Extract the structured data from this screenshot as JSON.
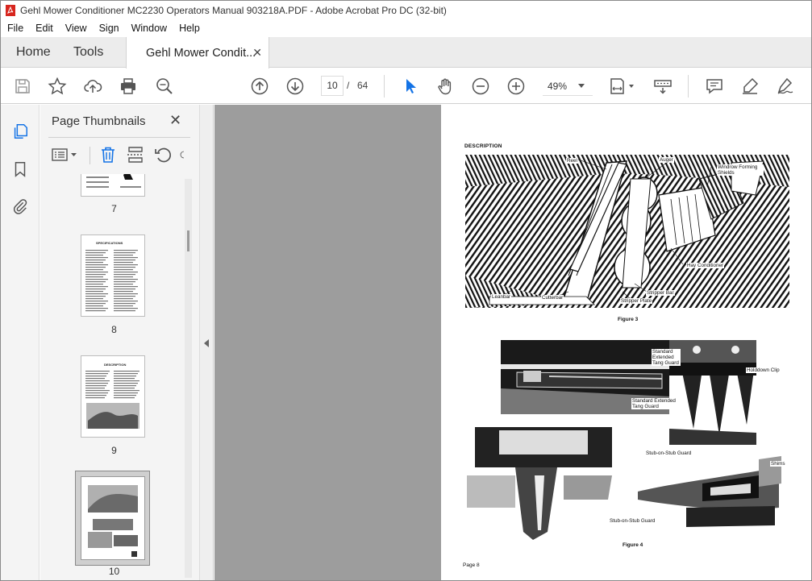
{
  "window": {
    "title": "Gehl Mower Conditioner MC2230 Operators Manual 903218A.PDF - Adobe Acrobat Pro DC (32-bit)"
  },
  "menu": [
    "File",
    "Edit",
    "View",
    "Sign",
    "Window",
    "Help"
  ],
  "tabs": {
    "home": "Home",
    "tools": "Tools",
    "document": "Gehl Mower Condit..."
  },
  "toolbar": {
    "current_page": "10",
    "page_separator": "/",
    "total_pages": "64",
    "zoom": "49%"
  },
  "thumbnails_panel": {
    "title": "Page Thumbnails",
    "pages": [
      {
        "label": "7"
      },
      {
        "label": "8",
        "heading": "SPECIFICATIONS"
      },
      {
        "label": "9",
        "heading": "DESCRIPTION"
      },
      {
        "label": "10",
        "selected": true
      }
    ]
  },
  "page": {
    "heading": "DESCRIPTION",
    "figure3": {
      "caption": "Figure 3",
      "labels": [
        "Reel",
        "Auger",
        "Windrow Forming Shields",
        "Hay Conditioner",
        "Stripper Bar",
        "Stripper Plate",
        "Leanbar",
        "Cutterbar"
      ]
    },
    "figure4": {
      "caption": "Figure 4",
      "labels": [
        "Standard Extended Tang Guard",
        "Holddown Clip",
        "Standard Extended Tang Guard",
        "Stub-on-Stub Guard",
        "Shims",
        "Stub-on-Stub Guard"
      ]
    },
    "footer": "Page 8"
  },
  "colors": {
    "acrobat_red": "#d7261e",
    "active_tool_blue": "#1473e6",
    "doc_background": "#9d9d9d"
  }
}
